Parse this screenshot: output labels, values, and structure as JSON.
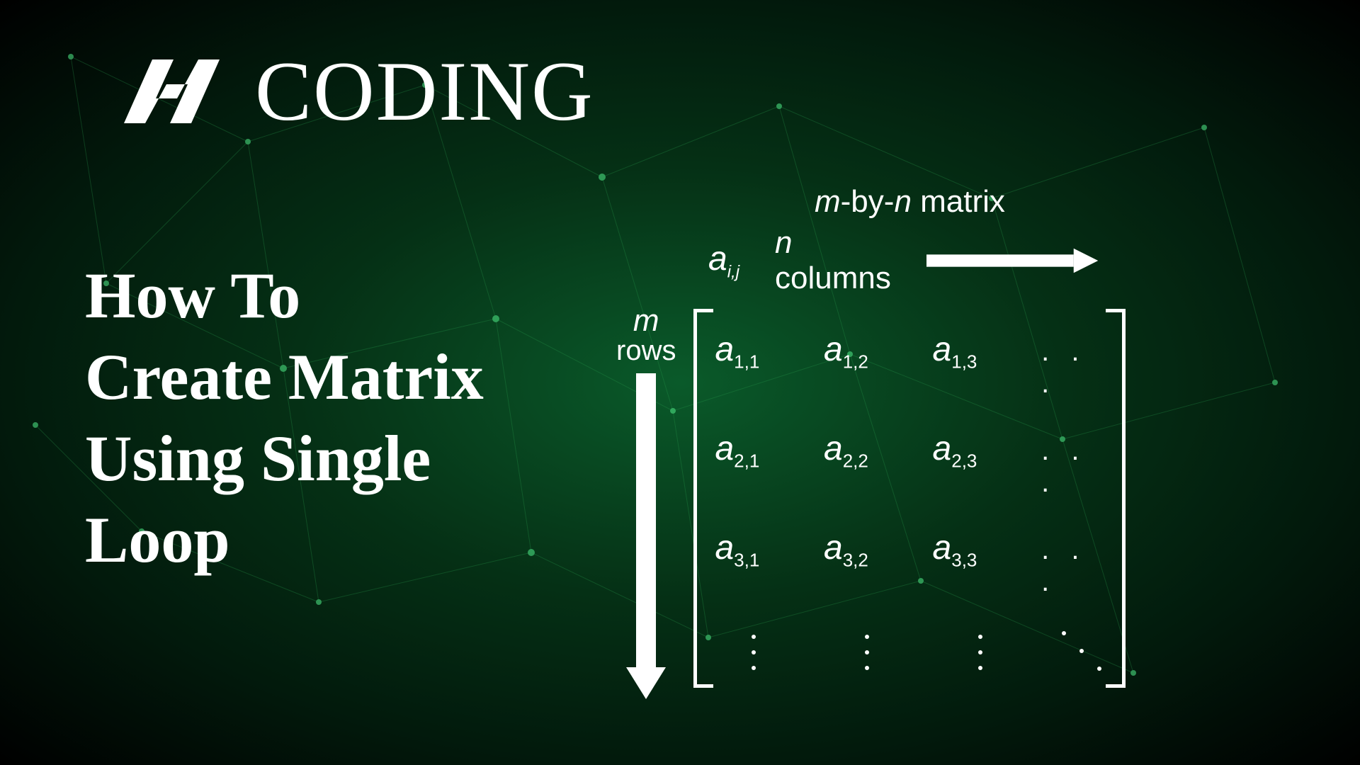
{
  "logo": {
    "text": "CODING"
  },
  "title": {
    "line1": "How To",
    "line2": "Create Matrix",
    "line3": "Using Single",
    "line4": "Loop"
  },
  "diagram": {
    "header_m": "m",
    "header_by": "-by-",
    "header_n": "n",
    "header_matrix": " matrix",
    "aij_a": "a",
    "aij_sub": "i,j",
    "ncols_n": "n",
    "ncols_text": " columns",
    "m_label": "m",
    "rows_label": "rows",
    "cells": {
      "a": "a",
      "r1c1": "1,1",
      "r1c2": "1,2",
      "r1c3": "1,3",
      "r2c1": "2,1",
      "r2c2": "2,2",
      "r2c3": "2,3",
      "r3c1": "3,1",
      "r3c2": "3,2",
      "r3c3": "3,3"
    },
    "hdots": ". . ."
  }
}
